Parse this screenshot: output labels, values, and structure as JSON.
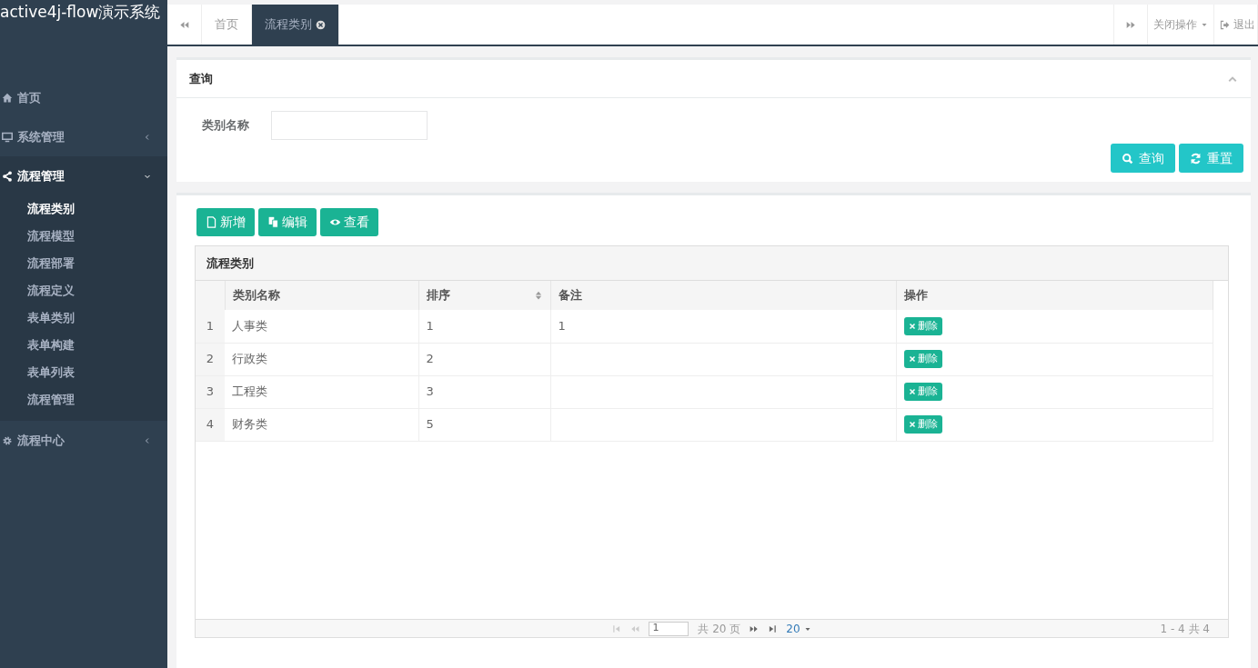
{
  "sidebar": {
    "title": "active4j-flow演示系统",
    "items": [
      {
        "label": "首页"
      },
      {
        "label": "系统管理",
        "expanded": false
      },
      {
        "label": "流程管理",
        "expanded": true,
        "children": [
          {
            "label": "流程类别",
            "selected": true
          },
          {
            "label": "流程模型",
            "selected": false
          },
          {
            "label": "流程部署",
            "selected": false
          },
          {
            "label": "流程定义",
            "selected": false
          },
          {
            "label": "表单类别",
            "selected": false
          },
          {
            "label": "表单构建",
            "selected": false
          },
          {
            "label": "表单列表",
            "selected": false
          },
          {
            "label": "流程管理",
            "selected": false
          }
        ]
      },
      {
        "label": "流程中心",
        "expanded": false
      }
    ]
  },
  "tabs": [
    {
      "label": "首页",
      "selected": false
    },
    {
      "label": "流程类别",
      "selected": true
    }
  ],
  "tab_actions": {
    "close_menu": "关闭操作",
    "logout": "退出"
  },
  "query": {
    "title": "查询",
    "field_label": "类别名称",
    "buttons": [
      "查询",
      "重置"
    ]
  },
  "toolbar": [
    "新增",
    "编辑",
    "查看"
  ],
  "table": {
    "caption": "流程类别",
    "columns": [
      {
        "label": "类别名称",
        "sortable": false
      },
      {
        "label": "排序",
        "sortable": true
      },
      {
        "label": "备注",
        "sortable": false
      },
      {
        "label": "操作",
        "sortable": false
      }
    ],
    "rows": [
      {
        "index": "1",
        "name": "人事类",
        "order": "1",
        "note": "1",
        "action": "删除"
      },
      {
        "index": "2",
        "name": "行政类",
        "order": "2",
        "note": "",
        "action": "删除"
      },
      {
        "index": "3",
        "name": "工程类",
        "order": "3",
        "note": "",
        "action": "删除"
      },
      {
        "index": "4",
        "name": "财务类",
        "order": "5",
        "note": "",
        "action": "删除"
      }
    ]
  },
  "pager": {
    "page": "1",
    "total_pages": "共 20 页",
    "page_size": "20",
    "summary": "1 - 4 共 4"
  }
}
